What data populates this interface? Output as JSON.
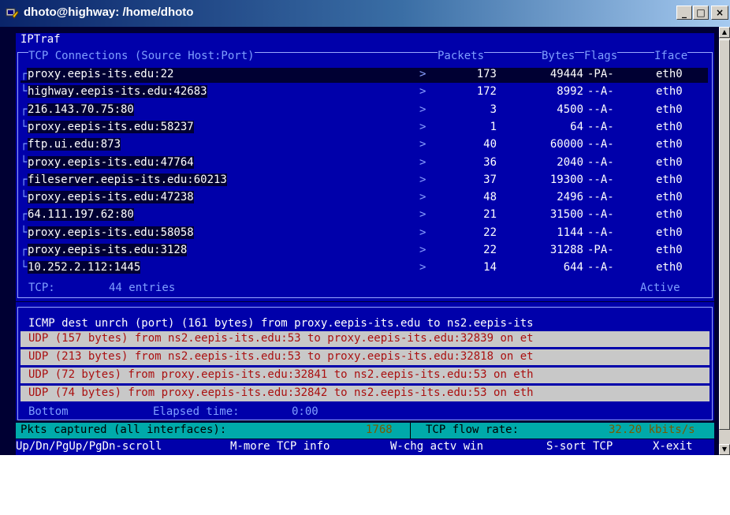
{
  "window": {
    "title": "dhoto@highway: /home/dhoto",
    "buttons": {
      "minimize": "_",
      "maximize": "□",
      "close": "×"
    }
  },
  "app": {
    "name": "IPTraf"
  },
  "tcp_panel": {
    "header": {
      "title": "TCP Connections (Source Host:Port)",
      "packets": "Packets",
      "bytes": "Bytes",
      "flags": "Flags",
      "iface": "Iface"
    },
    "rows": [
      {
        "host": "proxy.eepis-its.edu:22",
        "arrow": ">",
        "packets": "173",
        "bytes": "49444",
        "flags": "-PA-",
        "iface": "eth0"
      },
      {
        "host": "highway.eepis-its.edu:42683",
        "arrow": ">",
        "packets": "172",
        "bytes": "8992",
        "flags": "--A-",
        "iface": "eth0"
      },
      {
        "host": "216.143.70.75:80",
        "arrow": ">",
        "packets": "3",
        "bytes": "4500",
        "flags": "--A-",
        "iface": "eth0"
      },
      {
        "host": "proxy.eepis-its.edu:58237",
        "arrow": ">",
        "packets": "1",
        "bytes": "64",
        "flags": "--A-",
        "iface": "eth0"
      },
      {
        "host": "ftp.ui.edu:873",
        "arrow": ">",
        "packets": "40",
        "bytes": "60000",
        "flags": "--A-",
        "iface": "eth0"
      },
      {
        "host": "proxy.eepis-its.edu:47764",
        "arrow": ">",
        "packets": "36",
        "bytes": "2040",
        "flags": "--A-",
        "iface": "eth0"
      },
      {
        "host": "fileserver.eepis-its.edu:60213",
        "arrow": ">",
        "packets": "37",
        "bytes": "19300",
        "flags": "--A-",
        "iface": "eth0"
      },
      {
        "host": "proxy.eepis-its.edu:47238",
        "arrow": ">",
        "packets": "48",
        "bytes": "2496",
        "flags": "--A-",
        "iface": "eth0"
      },
      {
        "host": "64.111.197.62:80",
        "arrow": ">",
        "packets": "21",
        "bytes": "31500",
        "flags": "--A-",
        "iface": "eth0"
      },
      {
        "host": "proxy.eepis-its.edu:58058",
        "arrow": ">",
        "packets": "22",
        "bytes": "1144",
        "flags": "--A-",
        "iface": "eth0"
      },
      {
        "host": "proxy.eepis-its.edu:3128",
        "arrow": ">",
        "packets": "22",
        "bytes": "31288",
        "flags": "-PA-",
        "iface": "eth0"
      },
      {
        "host": "10.252.2.112:1445",
        "arrow": ">",
        "packets": "14",
        "bytes": "644",
        "flags": "--A-",
        "iface": "eth0"
      }
    ],
    "footer": {
      "label": "TCP:",
      "entries": "44 entries",
      "status": "Active"
    }
  },
  "other_panel": {
    "lines": [
      "ICMP dest unrch (port) (161 bytes) from proxy.eepis-its.edu to ns2.eepis-its",
      "UDP (157 bytes) from ns2.eepis-its.edu:53 to proxy.eepis-its.edu:32839 on et",
      "UDP (213 bytes) from ns2.eepis-its.edu:53 to proxy.eepis-its.edu:32818 on et",
      "UDP (72 bytes) from proxy.eepis-its.edu:32841 to ns2.eepis-its.edu:53 on eth",
      "UDP (74 bytes) from proxy.eepis-its.edu:32842 to ns2.eepis-its.edu:53 on eth"
    ],
    "footer": {
      "bottom": "Bottom",
      "elapsed_label": "Elapsed time:",
      "elapsed_value": "0:00"
    }
  },
  "status_bar": {
    "pkts_label": "Pkts captured (all interfaces):",
    "pkts_value": "1768",
    "rate_label": "TCP flow rate:",
    "rate_value": "32.20 kbits/s"
  },
  "help_bar": {
    "scroll": "Up/Dn/PgUp/PgDn-scroll",
    "more": "M-more TCP info",
    "chg": "W-chg actv win",
    "sort": "S-sort TCP",
    "exit": "X-exit"
  },
  "colors": {
    "terminal_bg": "#000033",
    "panel_blue": "#0000aa",
    "status_cyan": "#00aaaa",
    "udp_red": "#aa1010"
  }
}
